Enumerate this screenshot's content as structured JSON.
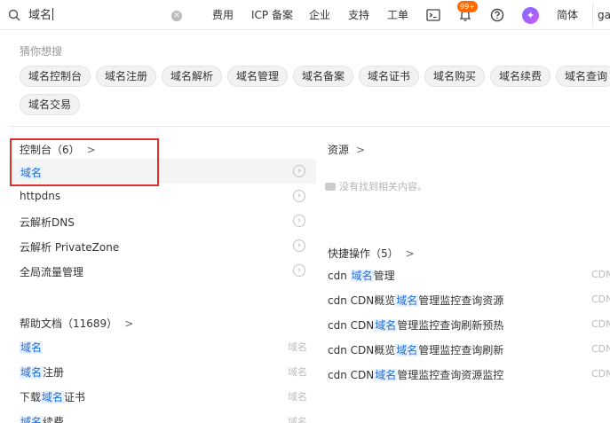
{
  "search": {
    "query": "域名",
    "search_icon": "search-icon",
    "clear_icon": "close-circle-icon"
  },
  "nav": {
    "items": [
      "费用",
      "ICP 备案",
      "企业",
      "支持",
      "工单"
    ],
    "terminal_icon": "terminal-icon",
    "bell_icon": "bell-icon",
    "bell_badge": "99+",
    "help_icon": "help-circle-icon",
    "ai_icon": "ai-assistant-icon",
    "language": "简体",
    "account_partial": "ga"
  },
  "suggest": {
    "title": "猜你想搜",
    "tags": [
      "域名控制台",
      "域名注册",
      "域名解析",
      "域名管理",
      "域名备案",
      "域名证书",
      "域名购买",
      "域名续费",
      "域名查询",
      "域名交易"
    ]
  },
  "console": {
    "title": "控制台（6）",
    "chev": ">",
    "items": [
      "域名",
      "httpdns",
      "云解析DNS",
      "云解析 PrivateZone",
      "全局流量管理"
    ]
  },
  "docs": {
    "title": "帮助文档（11689）",
    "chev": ">",
    "meta": "域名",
    "items": [
      {
        "pre": "",
        "hl": "域名",
        "post": ""
      },
      {
        "pre": "",
        "hl": "域名",
        "post": "注册"
      },
      {
        "pre": "下载",
        "hl": "域名",
        "post": "证书"
      },
      {
        "pre": "",
        "hl": "域名",
        "post": "续费"
      }
    ]
  },
  "resources": {
    "title": "资源",
    "chev": ">",
    "empty_icon": "cloud-icon",
    "empty_text": "没有找到相关内容。"
  },
  "quick": {
    "title": "快捷操作（5）",
    "chev": ">",
    "meta": "CDN",
    "items": [
      {
        "pre": "cdn ",
        "hl": "域名",
        "post": "管理"
      },
      {
        "pre": "cdn CDN概览",
        "hl": "域名",
        "post": "管理监控查询资源"
      },
      {
        "pre": "cdn CDN",
        "hl": "域名",
        "post": "管理监控查询刷新预热"
      },
      {
        "pre": "cdn CDN概览",
        "hl": "域名",
        "post": "管理监控查询刷新"
      },
      {
        "pre": "cdn CDN",
        "hl": "域名",
        "post": "管理监控查询资源监控"
      }
    ]
  }
}
